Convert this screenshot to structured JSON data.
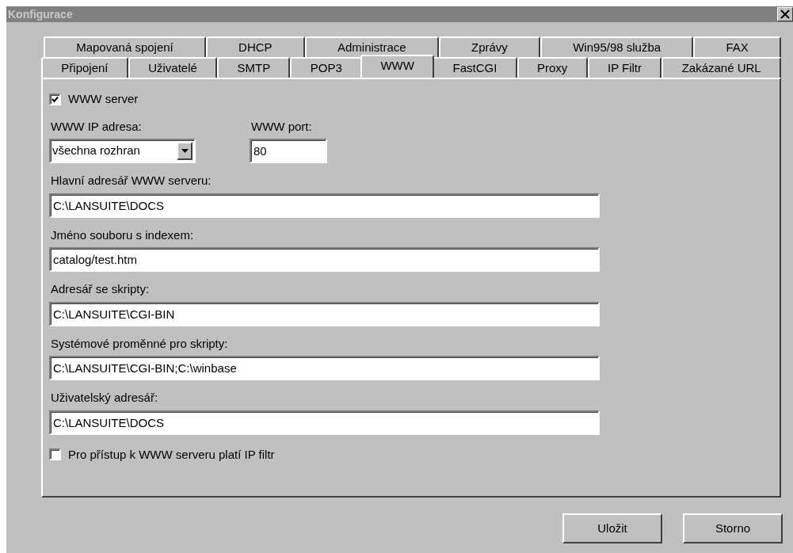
{
  "window": {
    "title": "Konfigurace"
  },
  "tab_rows": [
    [
      {
        "label": "Mapovaná spojení",
        "selected": false
      },
      {
        "label": "DHCP",
        "selected": false
      },
      {
        "label": "Administrace",
        "selected": false
      },
      {
        "label": "Zprávy",
        "selected": false
      },
      {
        "label": "Win95/98 služba",
        "selected": false
      },
      {
        "label": "FAX",
        "selected": false
      }
    ],
    [
      {
        "label": "Připojení",
        "selected": false
      },
      {
        "label": "Uživatelé",
        "selected": false
      },
      {
        "label": "SMTP",
        "selected": false
      },
      {
        "label": "POP3",
        "selected": false
      },
      {
        "label": "WWW",
        "selected": true
      },
      {
        "label": "FastCGI",
        "selected": false
      },
      {
        "label": "Proxy",
        "selected": false
      },
      {
        "label": "IP Filtr",
        "selected": false
      },
      {
        "label": "Zakázané URL",
        "selected": false
      }
    ]
  ],
  "www_server": {
    "label": "WWW server",
    "checked": true
  },
  "ip_address": {
    "label": "WWW IP adresa:",
    "value": "všechna rozhran"
  },
  "port": {
    "label": "WWW port:",
    "value": "80"
  },
  "fields": [
    {
      "label": "Hlavní adresář WWW serveru:",
      "value": "C:\\LANSUITE\\DOCS"
    },
    {
      "label": "Jméno souboru s indexem:",
      "value": "catalog/test.htm"
    },
    {
      "label": "Adresář se skripty:",
      "value": "C:\\LANSUITE\\CGI-BIN"
    },
    {
      "label": "Systémové proměnné pro skripty:",
      "value": "C:\\LANSUITE\\CGI-BIN;C:\\winbase"
    },
    {
      "label": "Uživatelský adresář:",
      "value": "C:\\LANSUITE\\DOCS"
    }
  ],
  "ip_filter": {
    "label": "Pro přístup k WWW serveru platí IP filtr",
    "checked": false
  },
  "buttons": [
    "Uložit",
    "Storno"
  ]
}
